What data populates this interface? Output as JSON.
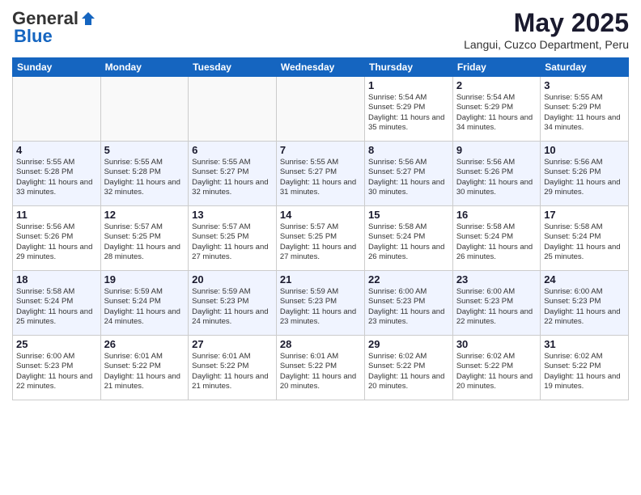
{
  "header": {
    "logo_general": "General",
    "logo_blue": "Blue",
    "month_title": "May 2025",
    "location": "Langui, Cuzco Department, Peru"
  },
  "weekdays": [
    "Sunday",
    "Monday",
    "Tuesday",
    "Wednesday",
    "Thursday",
    "Friday",
    "Saturday"
  ],
  "weeks": [
    [
      {
        "day": "",
        "sunrise": "",
        "sunset": "",
        "daylight": ""
      },
      {
        "day": "",
        "sunrise": "",
        "sunset": "",
        "daylight": ""
      },
      {
        "day": "",
        "sunrise": "",
        "sunset": "",
        "daylight": ""
      },
      {
        "day": "",
        "sunrise": "",
        "sunset": "",
        "daylight": ""
      },
      {
        "day": "1",
        "sunrise": "5:54 AM",
        "sunset": "5:29 PM",
        "daylight": "11 hours and 35 minutes."
      },
      {
        "day": "2",
        "sunrise": "5:54 AM",
        "sunset": "5:29 PM",
        "daylight": "11 hours and 34 minutes."
      },
      {
        "day": "3",
        "sunrise": "5:55 AM",
        "sunset": "5:29 PM",
        "daylight": "11 hours and 34 minutes."
      }
    ],
    [
      {
        "day": "4",
        "sunrise": "5:55 AM",
        "sunset": "5:28 PM",
        "daylight": "11 hours and 33 minutes."
      },
      {
        "day": "5",
        "sunrise": "5:55 AM",
        "sunset": "5:28 PM",
        "daylight": "11 hours and 32 minutes."
      },
      {
        "day": "6",
        "sunrise": "5:55 AM",
        "sunset": "5:27 PM",
        "daylight": "11 hours and 32 minutes."
      },
      {
        "day": "7",
        "sunrise": "5:55 AM",
        "sunset": "5:27 PM",
        "daylight": "11 hours and 31 minutes."
      },
      {
        "day": "8",
        "sunrise": "5:56 AM",
        "sunset": "5:27 PM",
        "daylight": "11 hours and 30 minutes."
      },
      {
        "day": "9",
        "sunrise": "5:56 AM",
        "sunset": "5:26 PM",
        "daylight": "11 hours and 30 minutes."
      },
      {
        "day": "10",
        "sunrise": "5:56 AM",
        "sunset": "5:26 PM",
        "daylight": "11 hours and 29 minutes."
      }
    ],
    [
      {
        "day": "11",
        "sunrise": "5:56 AM",
        "sunset": "5:26 PM",
        "daylight": "11 hours and 29 minutes."
      },
      {
        "day": "12",
        "sunrise": "5:57 AM",
        "sunset": "5:25 PM",
        "daylight": "11 hours and 28 minutes."
      },
      {
        "day": "13",
        "sunrise": "5:57 AM",
        "sunset": "5:25 PM",
        "daylight": "11 hours and 27 minutes."
      },
      {
        "day": "14",
        "sunrise": "5:57 AM",
        "sunset": "5:25 PM",
        "daylight": "11 hours and 27 minutes."
      },
      {
        "day": "15",
        "sunrise": "5:58 AM",
        "sunset": "5:24 PM",
        "daylight": "11 hours and 26 minutes."
      },
      {
        "day": "16",
        "sunrise": "5:58 AM",
        "sunset": "5:24 PM",
        "daylight": "11 hours and 26 minutes."
      },
      {
        "day": "17",
        "sunrise": "5:58 AM",
        "sunset": "5:24 PM",
        "daylight": "11 hours and 25 minutes."
      }
    ],
    [
      {
        "day": "18",
        "sunrise": "5:58 AM",
        "sunset": "5:24 PM",
        "daylight": "11 hours and 25 minutes."
      },
      {
        "day": "19",
        "sunrise": "5:59 AM",
        "sunset": "5:24 PM",
        "daylight": "11 hours and 24 minutes."
      },
      {
        "day": "20",
        "sunrise": "5:59 AM",
        "sunset": "5:23 PM",
        "daylight": "11 hours and 24 minutes."
      },
      {
        "day": "21",
        "sunrise": "5:59 AM",
        "sunset": "5:23 PM",
        "daylight": "11 hours and 23 minutes."
      },
      {
        "day": "22",
        "sunrise": "6:00 AM",
        "sunset": "5:23 PM",
        "daylight": "11 hours and 23 minutes."
      },
      {
        "day": "23",
        "sunrise": "6:00 AM",
        "sunset": "5:23 PM",
        "daylight": "11 hours and 22 minutes."
      },
      {
        "day": "24",
        "sunrise": "6:00 AM",
        "sunset": "5:23 PM",
        "daylight": "11 hours and 22 minutes."
      }
    ],
    [
      {
        "day": "25",
        "sunrise": "6:00 AM",
        "sunset": "5:23 PM",
        "daylight": "11 hours and 22 minutes."
      },
      {
        "day": "26",
        "sunrise": "6:01 AM",
        "sunset": "5:22 PM",
        "daylight": "11 hours and 21 minutes."
      },
      {
        "day": "27",
        "sunrise": "6:01 AM",
        "sunset": "5:22 PM",
        "daylight": "11 hours and 21 minutes."
      },
      {
        "day": "28",
        "sunrise": "6:01 AM",
        "sunset": "5:22 PM",
        "daylight": "11 hours and 20 minutes."
      },
      {
        "day": "29",
        "sunrise": "6:02 AM",
        "sunset": "5:22 PM",
        "daylight": "11 hours and 20 minutes."
      },
      {
        "day": "30",
        "sunrise": "6:02 AM",
        "sunset": "5:22 PM",
        "daylight": "11 hours and 20 minutes."
      },
      {
        "day": "31",
        "sunrise": "6:02 AM",
        "sunset": "5:22 PM",
        "daylight": "11 hours and 19 minutes."
      }
    ]
  ]
}
